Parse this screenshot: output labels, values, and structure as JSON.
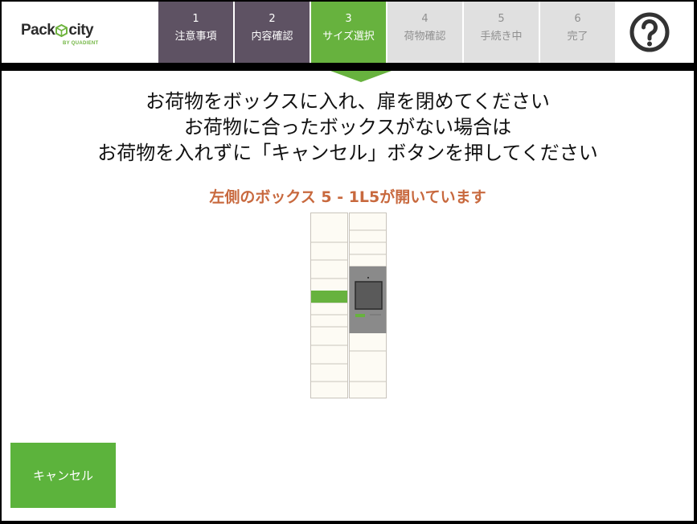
{
  "header": {
    "logo": {
      "brand_left": "Pack",
      "brand_right": "city",
      "sub": "BY QUADIENT"
    },
    "steps": [
      {
        "num": "1",
        "label": "注意事項",
        "state": "done"
      },
      {
        "num": "2",
        "label": "内容確認",
        "state": "done"
      },
      {
        "num": "3",
        "label": "サイズ選択",
        "state": "active"
      },
      {
        "num": "4",
        "label": "荷物確認",
        "state": "todo"
      },
      {
        "num": "5",
        "label": "手続き中",
        "state": "todo"
      },
      {
        "num": "6",
        "label": "完了",
        "state": "todo"
      }
    ],
    "help_icon": "question-circle-icon"
  },
  "main": {
    "instructions": [
      "お荷物をボックスに入れ、扉を閉めてください",
      "お荷物に合ったボックスがない場合は",
      "お荷物を入れずに「キャンセル」ボタンを押してください"
    ],
    "open_box_message": "左側のボックス 5 - 1L5が開いています"
  },
  "footer": {
    "cancel_label": "キャンセル"
  },
  "colors": {
    "step_done": "#5e5263",
    "step_active": "#67b23e",
    "step_todo": "#e0e0e0",
    "highlight_box": "#67b23e",
    "message_orange": "#c8693e",
    "cancel_button": "#5cb33c",
    "locker_cell": "#fdfbf4",
    "terminal_gray": "#8a8a8a"
  }
}
